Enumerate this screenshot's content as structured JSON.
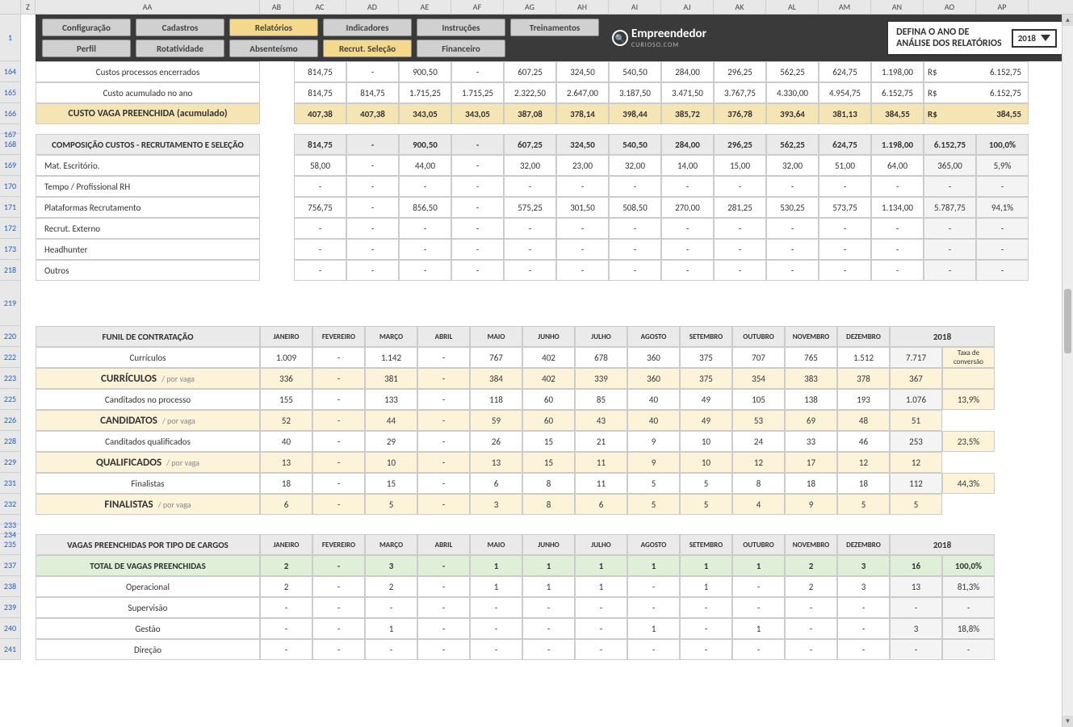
{
  "columns": [
    "Z",
    "AA",
    "AB",
    "AC",
    "AD",
    "AE",
    "AF",
    "AG",
    "AH",
    "AI",
    "AJ",
    "AK",
    "AL",
    "AM",
    "AN",
    "AO",
    "AP"
  ],
  "row_numbers": [
    "1",
    "164",
    "165",
    "166",
    "167",
    "168",
    "169",
    "170",
    "171",
    "172",
    "173",
    "218",
    "219",
    "220",
    "222",
    "223",
    "225",
    "226",
    "228",
    "229",
    "231",
    "232",
    "233",
    "234",
    "235",
    "237",
    "238",
    "239",
    "240",
    "241"
  ],
  "toolbar": {
    "row1": [
      "Configuração",
      "Cadastros",
      "Relatórios",
      "Indicadores",
      "Instruções"
    ],
    "row2": [
      "Perfil",
      "Rotatividade",
      "Absenteísmo",
      "Recrut. Seleção",
      "Financeiro",
      "Treinamentos"
    ],
    "active": [
      "Relatórios",
      "Recrut. Seleção"
    ],
    "logo_main": "Empreendedor",
    "logo_sub": "CURIOSO.COM",
    "year_label_1": "DEFINA O ANO DE",
    "year_label_2": "ANÁLISE DOS RELATÓRIOS",
    "year": "2018"
  },
  "months": [
    "JANEIRO",
    "FEVEREIRO",
    "MARÇO",
    "ABRIL",
    "MAIO",
    "JUNHO",
    "JULHO",
    "AGOSTO",
    "SETEMBRO",
    "OUTUBRO",
    "NOVEMBRO",
    "DEZEMBRO"
  ],
  "section1": {
    "rows": [
      {
        "label": "Custos processos encerrados",
        "v": [
          "814,75",
          "-",
          "900,50",
          "-",
          "607,25",
          "324,50",
          "540,50",
          "284,00",
          "296,25",
          "562,25",
          "624,75",
          "1.198,00"
        ],
        "rs": "R$",
        "tot": "6.152,75"
      },
      {
        "label": "Custo acumulado no ano",
        "v": [
          "814,75",
          "814,75",
          "1.715,25",
          "1.715,25",
          "2.322,50",
          "2.647,00",
          "3.187,50",
          "3.471,50",
          "3.767,75",
          "4.330,00",
          "4.954,75",
          "6.152,75"
        ],
        "rs": "R$",
        "tot": "6.152,75"
      },
      {
        "label": "CUSTO VAGA PREENCHIDA (acumulado)",
        "v": [
          "407,38",
          "407,38",
          "343,05",
          "343,05",
          "387,08",
          "378,14",
          "398,44",
          "385,72",
          "376,78",
          "393,64",
          "381,13",
          "384,55"
        ],
        "rs": "R$",
        "tot": "384,55",
        "yellow": true
      }
    ]
  },
  "section2": {
    "title": "COMPOSIÇÃO CUSTOS - RECRUTAMENTO E SELEÇÃO",
    "header_v": [
      "814,75",
      "-",
      "900,50",
      "-",
      "607,25",
      "324,50",
      "540,50",
      "284,00",
      "296,25",
      "562,25",
      "624,75",
      "1.198,00"
    ],
    "header_tot": "6.152,75",
    "header_pct": "100,0%",
    "rows": [
      {
        "label": "Mat. Escritório.",
        "v": [
          "58,00",
          "-",
          "44,00",
          "-",
          "32,00",
          "23,00",
          "32,00",
          "14,00",
          "15,00",
          "32,00",
          "51,00",
          "64,00"
        ],
        "tot": "365,00",
        "pct": "5,9%"
      },
      {
        "label": "Tempo / Profissional RH",
        "v": [
          "-",
          "-",
          "-",
          "-",
          "-",
          "-",
          "-",
          "-",
          "-",
          "-",
          "-",
          "-"
        ],
        "tot": "-",
        "pct": "-"
      },
      {
        "label": "Plataformas Recrutamento",
        "v": [
          "756,75",
          "-",
          "856,50",
          "-",
          "575,25",
          "301,50",
          "508,50",
          "270,00",
          "281,25",
          "530,25",
          "573,75",
          "1.134,00"
        ],
        "tot": "5.787,75",
        "pct": "94,1%"
      },
      {
        "label": "Recrut. Externo",
        "v": [
          "-",
          "-",
          "-",
          "-",
          "-",
          "-",
          "-",
          "-",
          "-",
          "-",
          "-",
          "-"
        ],
        "tot": "-",
        "pct": "-"
      },
      {
        "label": "Headhunter",
        "v": [
          "-",
          "-",
          "-",
          "-",
          "-",
          "-",
          "-",
          "-",
          "-",
          "-",
          "-",
          "-"
        ],
        "tot": "-",
        "pct": "-"
      },
      {
        "label": "Outros",
        "v": [
          "-",
          "-",
          "-",
          "-",
          "-",
          "-",
          "-",
          "-",
          "-",
          "-",
          "-",
          "-"
        ],
        "tot": "-",
        "pct": "-"
      }
    ]
  },
  "funil": {
    "title": "FUNIL DE CONTRATAÇÃO",
    "year_col": "2018",
    "taxa": "Taxa de conversão",
    "groups": [
      {
        "name": "Currículos",
        "v": [
          "1.009",
          "-",
          "1.142",
          "-",
          "767",
          "402",
          "678",
          "360",
          "375",
          "707",
          "765",
          "1.512"
        ],
        "tot": "7.717",
        "per_label": "CURRÍCULOS",
        "per_sub": "/ por vaga",
        "per_v": [
          "336",
          "-",
          "381",
          "-",
          "384",
          "402",
          "339",
          "360",
          "375",
          "354",
          "383",
          "378"
        ],
        "per_tot": "367",
        "pct": ""
      },
      {
        "name": "Canditados no processo",
        "v": [
          "155",
          "-",
          "133",
          "-",
          "118",
          "60",
          "85",
          "40",
          "49",
          "105",
          "138",
          "193"
        ],
        "tot": "1.076",
        "per_label": "CANDIDATOS",
        "per_sub": "/ por vaga",
        "per_v": [
          "52",
          "-",
          "44",
          "-",
          "59",
          "60",
          "43",
          "40",
          "49",
          "53",
          "69",
          "48"
        ],
        "per_tot": "51",
        "pct": "13,9%"
      },
      {
        "name": "Canditados qualificados",
        "v": [
          "40",
          "-",
          "29",
          "-",
          "26",
          "15",
          "21",
          "9",
          "10",
          "24",
          "33",
          "46"
        ],
        "tot": "253",
        "per_label": "QUALIFICADOS",
        "per_sub": "/ por vaga",
        "per_v": [
          "13",
          "-",
          "10",
          "-",
          "13",
          "15",
          "11",
          "9",
          "10",
          "12",
          "17",
          "12"
        ],
        "per_tot": "12",
        "pct": "23,5%"
      },
      {
        "name": "Finalistas",
        "v": [
          "18",
          "-",
          "15",
          "-",
          "6",
          "8",
          "11",
          "5",
          "5",
          "8",
          "18",
          "18"
        ],
        "tot": "112",
        "per_label": "FINALISTAS",
        "per_sub": "/ por vaga",
        "per_v": [
          "6",
          "-",
          "5",
          "-",
          "3",
          "8",
          "6",
          "5",
          "5",
          "4",
          "9",
          "5"
        ],
        "per_tot": "5",
        "pct": "44,3%"
      }
    ]
  },
  "vagas": {
    "title": "VAGAS PREENCHIDAS POR TIPO DE CARGOS",
    "year_col": "2018",
    "total_row": {
      "label": "TOTAL DE VAGAS PREENCHIDAS",
      "v": [
        "2",
        "-",
        "3",
        "-",
        "1",
        "1",
        "1",
        "1",
        "1",
        "1",
        "2",
        "3"
      ],
      "tot": "16",
      "pct": "100,0%"
    },
    "rows": [
      {
        "label": "Operacional",
        "v": [
          "2",
          "-",
          "2",
          "-",
          "1",
          "1",
          "1",
          "-",
          "1",
          "-",
          "2",
          "3"
        ],
        "tot": "13",
        "pct": "81,3%"
      },
      {
        "label": "Supervisão",
        "v": [
          "-",
          "-",
          "-",
          "-",
          "-",
          "-",
          "-",
          "-",
          "-",
          "-",
          "-",
          "-"
        ],
        "tot": "-",
        "pct": "-"
      },
      {
        "label": "Gestão",
        "v": [
          "-",
          "-",
          "1",
          "-",
          "-",
          "-",
          "-",
          "1",
          "-",
          "1",
          "-",
          "-"
        ],
        "tot": "3",
        "pct": "18,8%"
      },
      {
        "label": "Direção",
        "v": [
          "-",
          "-",
          "-",
          "-",
          "-",
          "-",
          "-",
          "-",
          "-",
          "-",
          "-",
          "-"
        ],
        "tot": "-",
        "pct": "-"
      }
    ]
  }
}
